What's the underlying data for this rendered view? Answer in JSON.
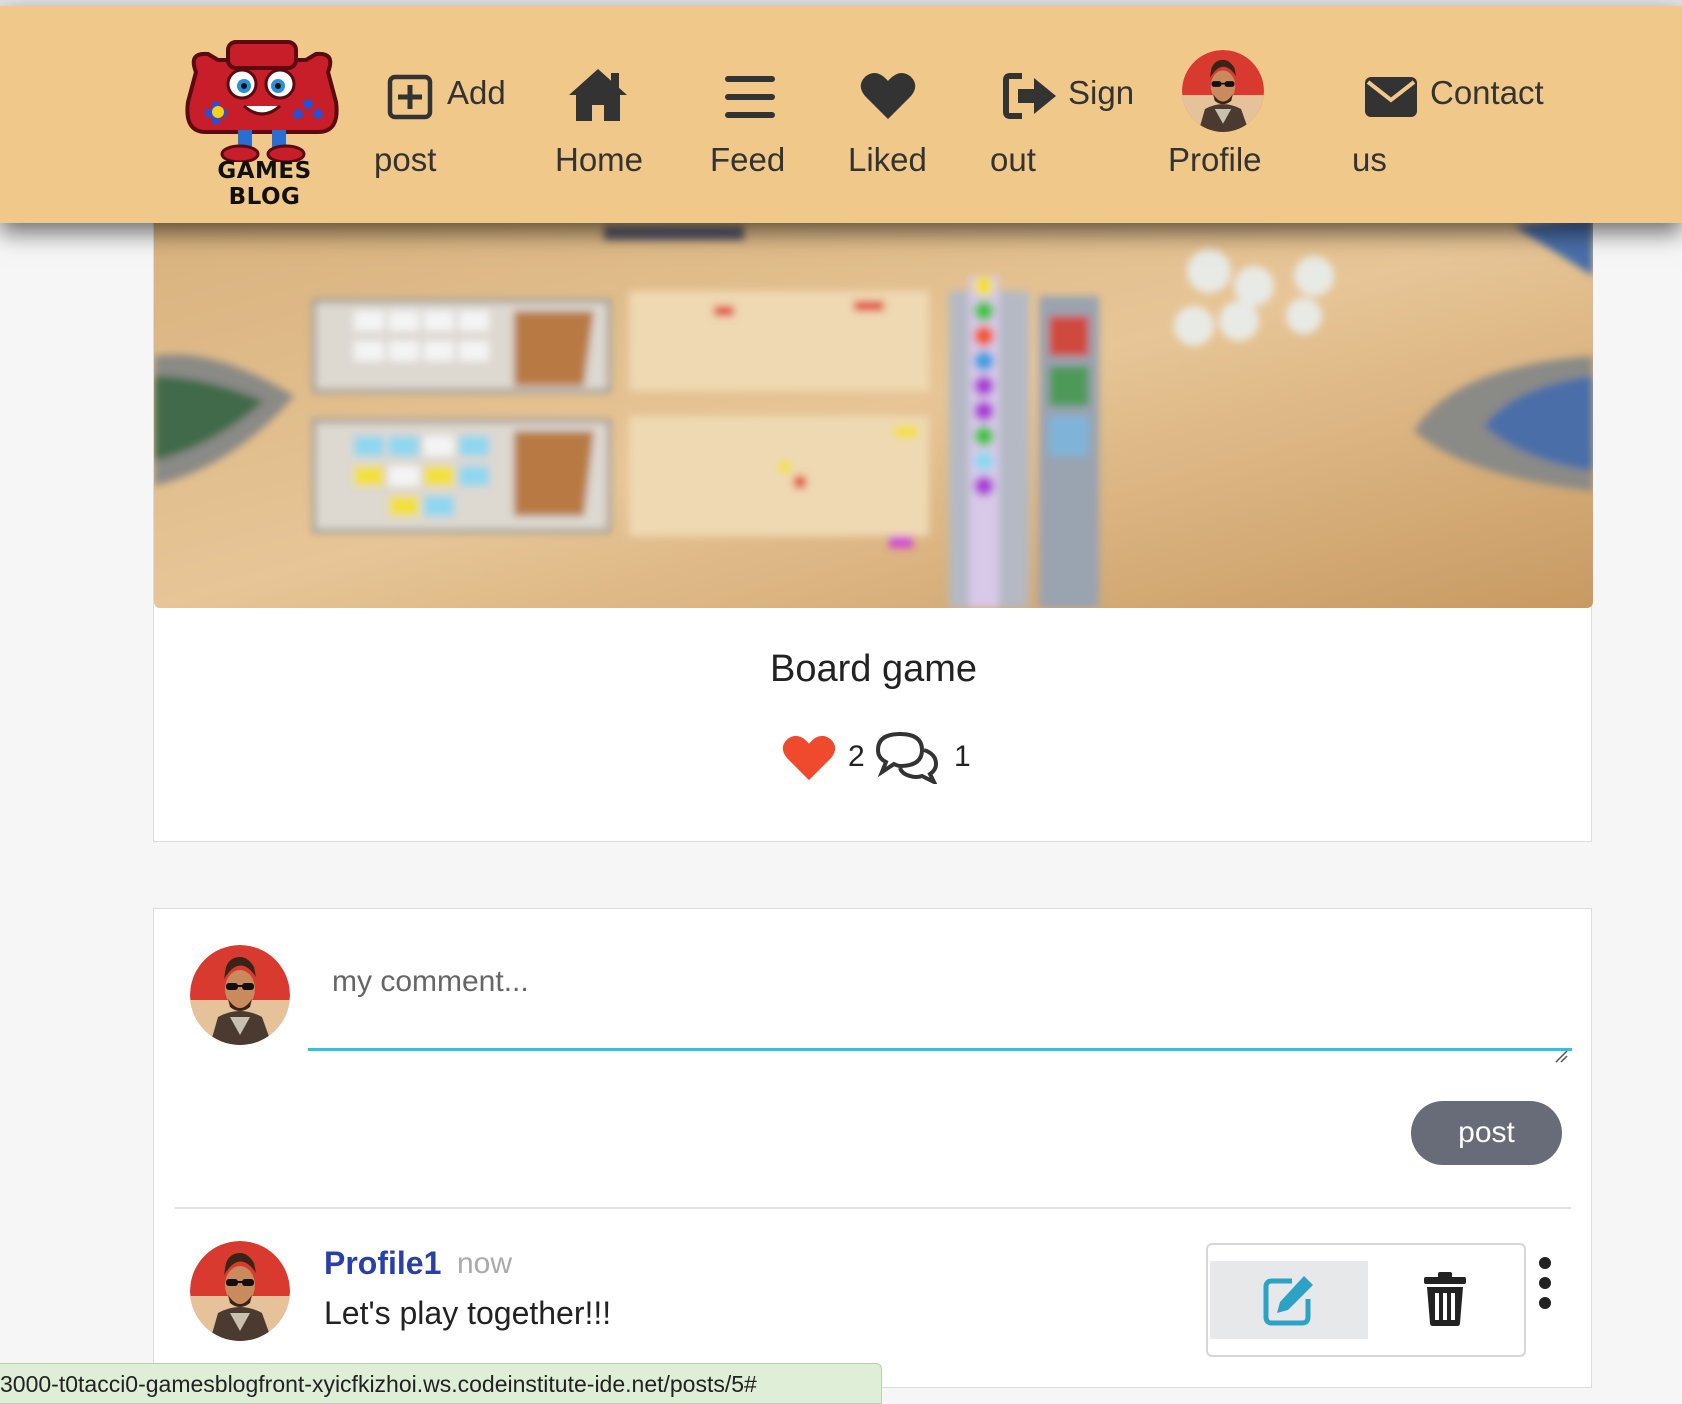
{
  "navbar": {
    "logo_text": "GAMES BLOG",
    "items": [
      {
        "line1": "Add",
        "line2": "post",
        "icon": "plus-square-icon"
      },
      {
        "line1": "Home",
        "icon": "home-icon"
      },
      {
        "line1": "Feed",
        "icon": "bars-icon"
      },
      {
        "line1": "Liked",
        "icon": "heart-icon"
      },
      {
        "line1": "Sign",
        "line2": "out",
        "icon": "sign-out-icon"
      },
      {
        "line1": "Profile",
        "icon": "avatar"
      },
      {
        "line1": "Contact",
        "line2": "us",
        "icon": "envelope-icon"
      }
    ],
    "background": "#f0c88a"
  },
  "post": {
    "title": "Board game",
    "likes_count": "2",
    "comments_count": "1",
    "like_color": "#f04a2e"
  },
  "comment_form": {
    "placeholder": "my comment...",
    "submit_label": "post"
  },
  "comments": [
    {
      "owner": "Profile1",
      "time": "now",
      "text": "Let's play together!!!",
      "actions": [
        "edit-icon",
        "trash-icon"
      ]
    }
  ],
  "status_bar": {
    "url": "3000-t0tacci0-gamesblogfront-xyicfkizhoi.ws.codeinstitute-ide.net/posts/5#"
  }
}
